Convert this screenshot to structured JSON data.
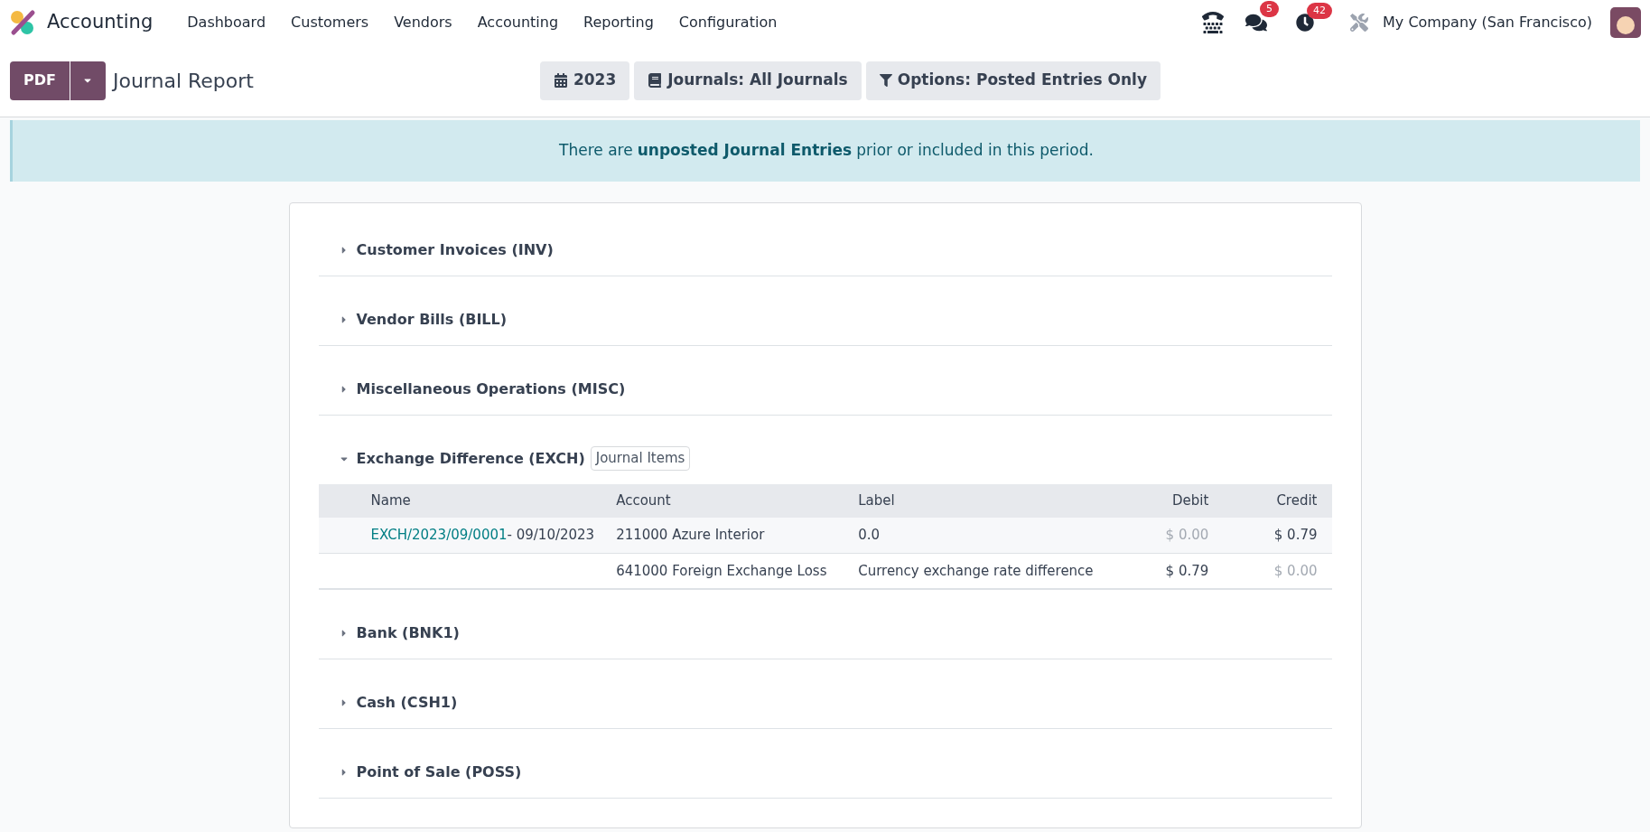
{
  "navbar": {
    "app_name": "Accounting",
    "menu": [
      "Dashboard",
      "Customers",
      "Vendors",
      "Accounting",
      "Reporting",
      "Configuration"
    ],
    "messages_badge": "5",
    "activities_badge": "42",
    "company": "My Company (San Francisco)"
  },
  "control_panel": {
    "print_button": "PDF",
    "title": "Journal Report",
    "filters": [
      {
        "kind": "date",
        "label": "2023"
      },
      {
        "kind": "journals",
        "label": "Journals: All Journals"
      },
      {
        "kind": "options",
        "label": "Options: Posted Entries Only"
      }
    ]
  },
  "alert": {
    "before": "There are",
    "link": "unposted Journal Entries",
    "after": "prior or included in this period."
  },
  "journals": [
    {
      "name": "Customer Invoices (INV)",
      "expanded": false
    },
    {
      "name": "Vendor Bills (BILL)",
      "expanded": false
    },
    {
      "name": "Miscellaneous Operations (MISC)",
      "expanded": false
    },
    {
      "name": "Exchange Difference (EXCH)",
      "expanded": true,
      "badge": "Journal Items",
      "table": {
        "columns": [
          "Name",
          "Account",
          "Label",
          "Debit",
          "Credit"
        ],
        "rows": [
          {
            "move": "EXCH/2023/09/0001",
            "date": "- 09/10/2023",
            "account": "211000 Azure Interior",
            "label": "0.0",
            "debit": {
              "text": "$ 0.00",
              "dimmed": true
            },
            "credit": {
              "text": "$ 0.79",
              "dimmed": false
            }
          },
          {
            "account": "641000 Foreign Exchange Loss",
            "label": "Currency exchange rate difference",
            "debit": {
              "text": "$ 0.79",
              "dimmed": false
            },
            "credit": {
              "text": "$ 0.00",
              "dimmed": true
            }
          }
        ]
      }
    },
    {
      "name": "Bank (BNK1)",
      "expanded": false
    },
    {
      "name": "Cash (CSH1)",
      "expanded": false
    },
    {
      "name": "Point of Sale (POSS)",
      "expanded": false
    }
  ]
}
